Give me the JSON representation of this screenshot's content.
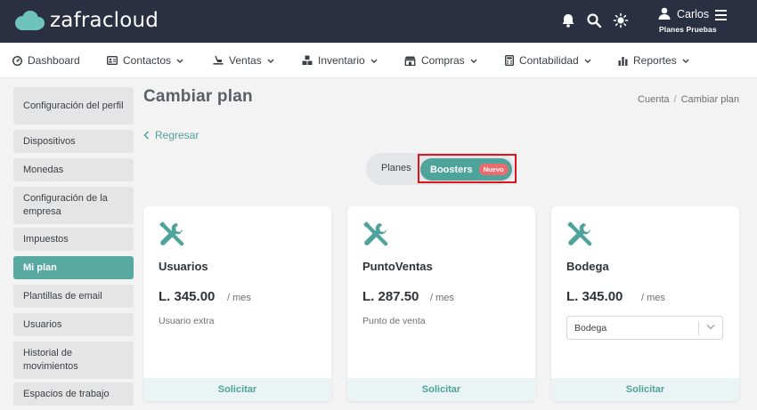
{
  "app": {
    "logo_text": "zafracloud",
    "user_name": "Carlos",
    "user_plan": "Planes Pruebas",
    "icons": [
      "bell-icon",
      "search-icon",
      "sun-icon",
      "user-icon",
      "hamburger-icon"
    ]
  },
  "nav": {
    "items": [
      {
        "label": "Dashboard",
        "icon": "dashboard-icon"
      },
      {
        "label": "Contactos",
        "icon": "contacts-icon"
      },
      {
        "label": "Ventas",
        "icon": "sales-icon"
      },
      {
        "label": "Inventario",
        "icon": "inventory-icon"
      },
      {
        "label": "Compras",
        "icon": "store-icon"
      },
      {
        "label": "Contabilidad",
        "icon": "calculator-icon"
      },
      {
        "label": "Reportes",
        "icon": "chart-icon"
      }
    ]
  },
  "sidebar": {
    "items": [
      {
        "label": "Configuración del perfil"
      },
      {
        "label": "Dispositivos"
      },
      {
        "label": "Monedas"
      },
      {
        "label": "Configuración de la empresa"
      },
      {
        "label": "Impuestos"
      },
      {
        "label": "Mi plan",
        "active": true
      },
      {
        "label": "Plantillas de email"
      },
      {
        "label": "Usuarios"
      },
      {
        "label": "Historial de movimientos"
      },
      {
        "label": "Espacios de trabajo"
      }
    ]
  },
  "main": {
    "title": "Cambiar plan",
    "breadcrumb": {
      "parent": "Cuenta",
      "separator": "/",
      "current": "Cambiar plan"
    },
    "back_label": "Regresar",
    "toggle": {
      "planes": "Planes",
      "boosters": "Boosters",
      "badge": "Nuevo"
    },
    "cards": [
      {
        "name": "Usuarios",
        "price": "L. 345.00",
        "period": "/ mes",
        "description": "Usuario extra",
        "action": "Solicitar"
      },
      {
        "name": "PuntoVentas",
        "price": "L. 287.50",
        "period": "/ mes",
        "description": "Punto de venta",
        "action": "Solicitar"
      },
      {
        "name": "Bodega",
        "price": "L. 345.00",
        "period": "/ mes",
        "select_value": "Bodega",
        "action": "Solicitar"
      }
    ]
  },
  "colors": {
    "topbar": "#2b2f42",
    "accent": "#4ea39a",
    "sidebar_active": "#58a9a1",
    "badge": "#ee6b6b",
    "highlight": "#e0141b"
  }
}
